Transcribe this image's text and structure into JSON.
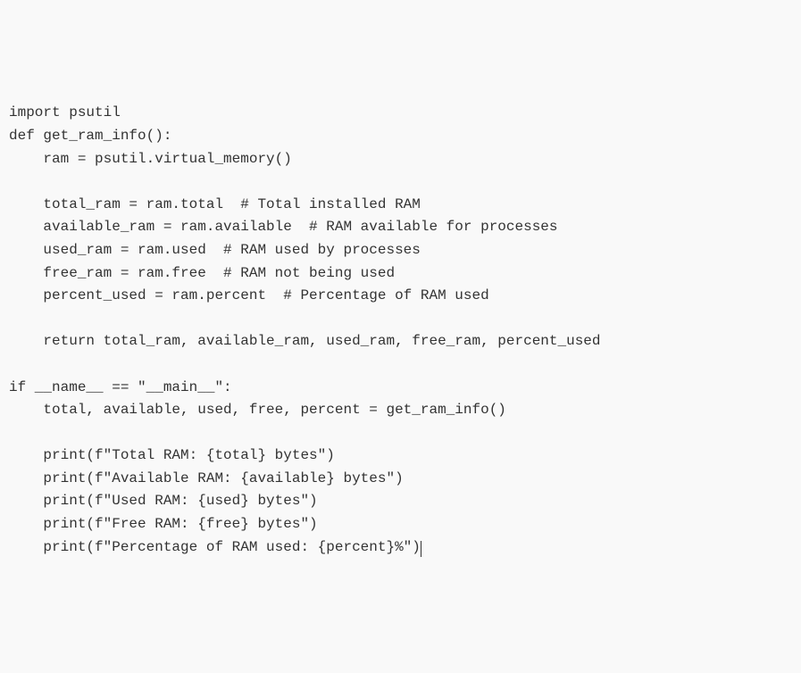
{
  "code": {
    "lines": [
      "import psutil",
      "def get_ram_info():",
      "    ram = psutil.virtual_memory()",
      "",
      "    total_ram = ram.total  # Total installed RAM",
      "    available_ram = ram.available  # RAM available for processes",
      "    used_ram = ram.used  # RAM used by processes",
      "    free_ram = ram.free  # RAM not being used",
      "    percent_used = ram.percent  # Percentage of RAM used",
      "",
      "    return total_ram, available_ram, used_ram, free_ram, percent_used",
      "",
      "if __name__ == \"__main__\":",
      "    total, available, used, free, percent = get_ram_info()",
      "",
      "    print(f\"Total RAM: {total} bytes\")",
      "    print(f\"Available RAM: {available} bytes\")",
      "    print(f\"Used RAM: {used} bytes\")",
      "    print(f\"Free RAM: {free} bytes\")",
      "    print(f\"Percentage of RAM used: {percent}%\")"
    ]
  }
}
